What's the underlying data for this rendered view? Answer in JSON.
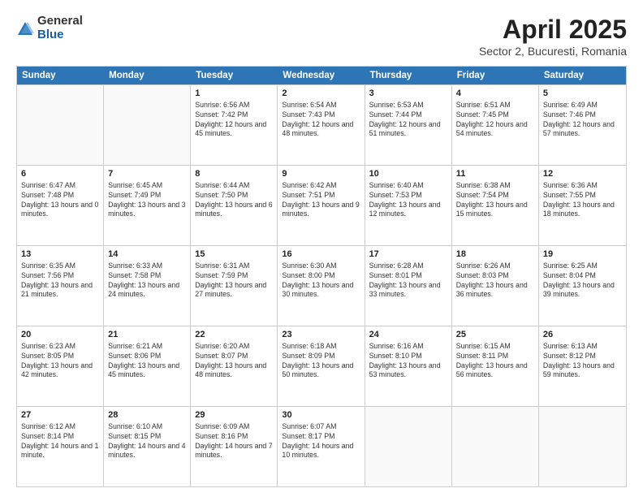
{
  "logo": {
    "general": "General",
    "blue": "Blue"
  },
  "title": {
    "main": "April 2025",
    "sub": "Sector 2, Bucuresti, Romania"
  },
  "days_header": [
    "Sunday",
    "Monday",
    "Tuesday",
    "Wednesday",
    "Thursday",
    "Friday",
    "Saturday"
  ],
  "weeks": [
    [
      {
        "day": "",
        "empty": true
      },
      {
        "day": "",
        "empty": true
      },
      {
        "day": "1",
        "sunrise": "Sunrise: 6:56 AM",
        "sunset": "Sunset: 7:42 PM",
        "daylight": "Daylight: 12 hours and 45 minutes."
      },
      {
        "day": "2",
        "sunrise": "Sunrise: 6:54 AM",
        "sunset": "Sunset: 7:43 PM",
        "daylight": "Daylight: 12 hours and 48 minutes."
      },
      {
        "day": "3",
        "sunrise": "Sunrise: 6:53 AM",
        "sunset": "Sunset: 7:44 PM",
        "daylight": "Daylight: 12 hours and 51 minutes."
      },
      {
        "day": "4",
        "sunrise": "Sunrise: 6:51 AM",
        "sunset": "Sunset: 7:45 PM",
        "daylight": "Daylight: 12 hours and 54 minutes."
      },
      {
        "day": "5",
        "sunrise": "Sunrise: 6:49 AM",
        "sunset": "Sunset: 7:46 PM",
        "daylight": "Daylight: 12 hours and 57 minutes."
      }
    ],
    [
      {
        "day": "6",
        "sunrise": "Sunrise: 6:47 AM",
        "sunset": "Sunset: 7:48 PM",
        "daylight": "Daylight: 13 hours and 0 minutes."
      },
      {
        "day": "7",
        "sunrise": "Sunrise: 6:45 AM",
        "sunset": "Sunset: 7:49 PM",
        "daylight": "Daylight: 13 hours and 3 minutes."
      },
      {
        "day": "8",
        "sunrise": "Sunrise: 6:44 AM",
        "sunset": "Sunset: 7:50 PM",
        "daylight": "Daylight: 13 hours and 6 minutes."
      },
      {
        "day": "9",
        "sunrise": "Sunrise: 6:42 AM",
        "sunset": "Sunset: 7:51 PM",
        "daylight": "Daylight: 13 hours and 9 minutes."
      },
      {
        "day": "10",
        "sunrise": "Sunrise: 6:40 AM",
        "sunset": "Sunset: 7:53 PM",
        "daylight": "Daylight: 13 hours and 12 minutes."
      },
      {
        "day": "11",
        "sunrise": "Sunrise: 6:38 AM",
        "sunset": "Sunset: 7:54 PM",
        "daylight": "Daylight: 13 hours and 15 minutes."
      },
      {
        "day": "12",
        "sunrise": "Sunrise: 6:36 AM",
        "sunset": "Sunset: 7:55 PM",
        "daylight": "Daylight: 13 hours and 18 minutes."
      }
    ],
    [
      {
        "day": "13",
        "sunrise": "Sunrise: 6:35 AM",
        "sunset": "Sunset: 7:56 PM",
        "daylight": "Daylight: 13 hours and 21 minutes."
      },
      {
        "day": "14",
        "sunrise": "Sunrise: 6:33 AM",
        "sunset": "Sunset: 7:58 PM",
        "daylight": "Daylight: 13 hours and 24 minutes."
      },
      {
        "day": "15",
        "sunrise": "Sunrise: 6:31 AM",
        "sunset": "Sunset: 7:59 PM",
        "daylight": "Daylight: 13 hours and 27 minutes."
      },
      {
        "day": "16",
        "sunrise": "Sunrise: 6:30 AM",
        "sunset": "Sunset: 8:00 PM",
        "daylight": "Daylight: 13 hours and 30 minutes."
      },
      {
        "day": "17",
        "sunrise": "Sunrise: 6:28 AM",
        "sunset": "Sunset: 8:01 PM",
        "daylight": "Daylight: 13 hours and 33 minutes."
      },
      {
        "day": "18",
        "sunrise": "Sunrise: 6:26 AM",
        "sunset": "Sunset: 8:03 PM",
        "daylight": "Daylight: 13 hours and 36 minutes."
      },
      {
        "day": "19",
        "sunrise": "Sunrise: 6:25 AM",
        "sunset": "Sunset: 8:04 PM",
        "daylight": "Daylight: 13 hours and 39 minutes."
      }
    ],
    [
      {
        "day": "20",
        "sunrise": "Sunrise: 6:23 AM",
        "sunset": "Sunset: 8:05 PM",
        "daylight": "Daylight: 13 hours and 42 minutes."
      },
      {
        "day": "21",
        "sunrise": "Sunrise: 6:21 AM",
        "sunset": "Sunset: 8:06 PM",
        "daylight": "Daylight: 13 hours and 45 minutes."
      },
      {
        "day": "22",
        "sunrise": "Sunrise: 6:20 AM",
        "sunset": "Sunset: 8:07 PM",
        "daylight": "Daylight: 13 hours and 48 minutes."
      },
      {
        "day": "23",
        "sunrise": "Sunrise: 6:18 AM",
        "sunset": "Sunset: 8:09 PM",
        "daylight": "Daylight: 13 hours and 50 minutes."
      },
      {
        "day": "24",
        "sunrise": "Sunrise: 6:16 AM",
        "sunset": "Sunset: 8:10 PM",
        "daylight": "Daylight: 13 hours and 53 minutes."
      },
      {
        "day": "25",
        "sunrise": "Sunrise: 6:15 AM",
        "sunset": "Sunset: 8:11 PM",
        "daylight": "Daylight: 13 hours and 56 minutes."
      },
      {
        "day": "26",
        "sunrise": "Sunrise: 6:13 AM",
        "sunset": "Sunset: 8:12 PM",
        "daylight": "Daylight: 13 hours and 59 minutes."
      }
    ],
    [
      {
        "day": "27",
        "sunrise": "Sunrise: 6:12 AM",
        "sunset": "Sunset: 8:14 PM",
        "daylight": "Daylight: 14 hours and 1 minute."
      },
      {
        "day": "28",
        "sunrise": "Sunrise: 6:10 AM",
        "sunset": "Sunset: 8:15 PM",
        "daylight": "Daylight: 14 hours and 4 minutes."
      },
      {
        "day": "29",
        "sunrise": "Sunrise: 6:09 AM",
        "sunset": "Sunset: 8:16 PM",
        "daylight": "Daylight: 14 hours and 7 minutes."
      },
      {
        "day": "30",
        "sunrise": "Sunrise: 6:07 AM",
        "sunset": "Sunset: 8:17 PM",
        "daylight": "Daylight: 14 hours and 10 minutes."
      },
      {
        "day": "",
        "empty": true
      },
      {
        "day": "",
        "empty": true
      },
      {
        "day": "",
        "empty": true
      }
    ]
  ]
}
